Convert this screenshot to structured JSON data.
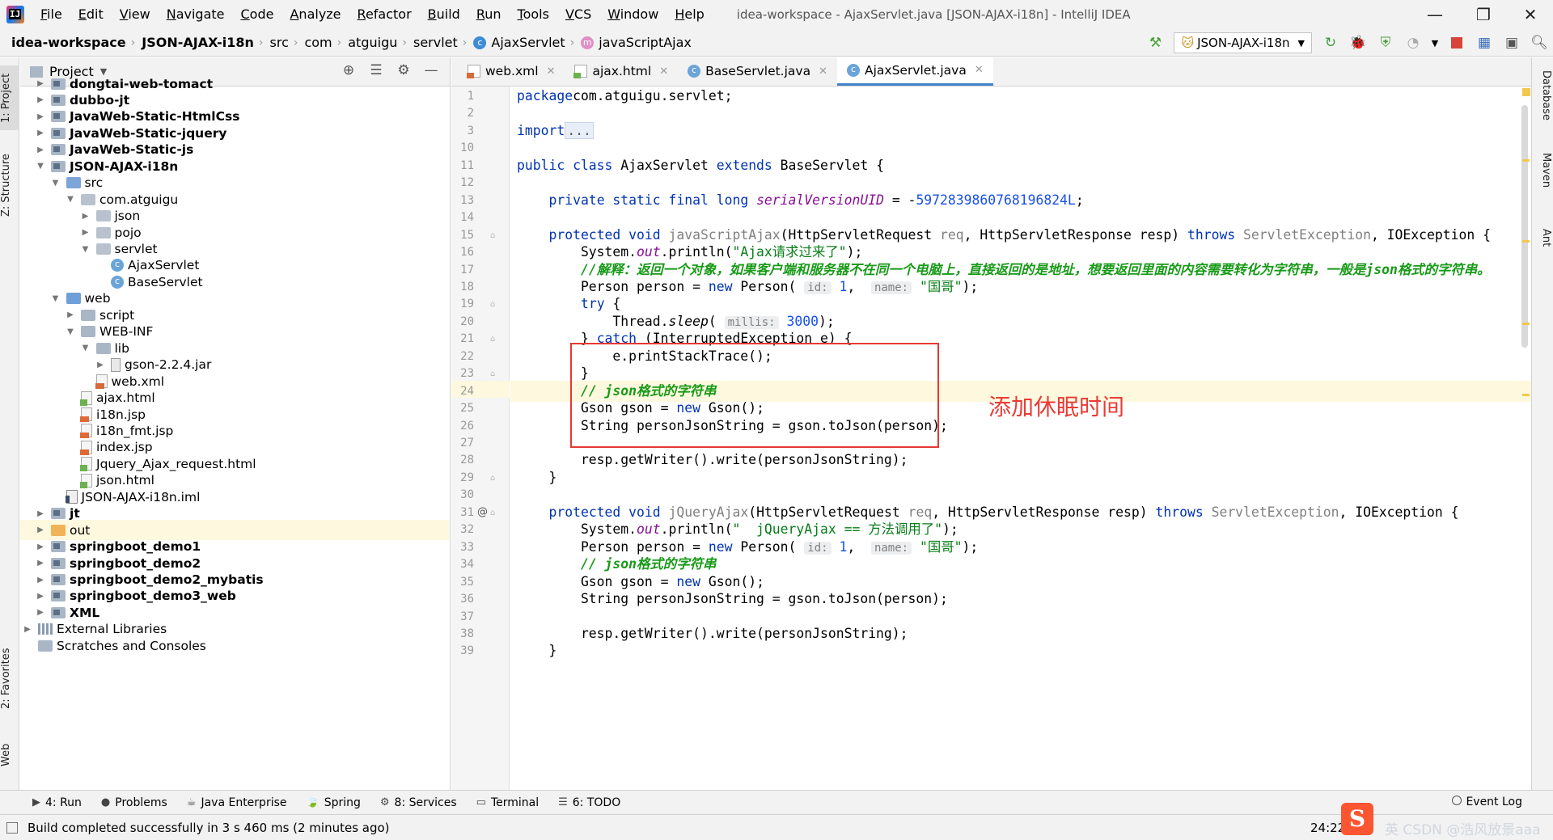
{
  "menubar": {
    "items": [
      "File",
      "Edit",
      "View",
      "Navigate",
      "Code",
      "Analyze",
      "Refactor",
      "Build",
      "Run",
      "Tools",
      "VCS",
      "Window",
      "Help"
    ],
    "title": "idea-workspace - AjaxServlet.java [JSON-AJAX-i18n] - IntelliJ IDEA",
    "minimize": "—",
    "maximize": "❐",
    "close": "✕"
  },
  "breadcrumbs": [
    "idea-workspace",
    "JSON-AJAX-i18n",
    "src",
    "com",
    "atguigu",
    "servlet",
    "AjaxServlet",
    "javaScriptAjax"
  ],
  "toolbar": {
    "run_config": "JSON-AJAX-i18n"
  },
  "left_strip": {
    "project": "1: Project",
    "structure": "Z: Structure",
    "favorites": "2: Favorites",
    "web": "Web"
  },
  "right_strip": {
    "database": "Database",
    "maven": "Maven",
    "ant": "Ant"
  },
  "project_panel": {
    "title": "Project",
    "tree": [
      {
        "label": "dongtai-web-tomact",
        "depth": 0,
        "arrow": "right",
        "icon": "folder-mod",
        "bold": true
      },
      {
        "label": "dubbo-jt",
        "depth": 0,
        "arrow": "right",
        "icon": "folder-mod",
        "bold": true
      },
      {
        "label": "JavaWeb-Static-HtmlCss",
        "depth": 0,
        "arrow": "right",
        "icon": "folder-mod",
        "bold": true
      },
      {
        "label": "JavaWeb-Static-jquery",
        "depth": 0,
        "arrow": "right",
        "icon": "folder-mod",
        "bold": true
      },
      {
        "label": "JavaWeb-Static-js",
        "depth": 0,
        "arrow": "right",
        "icon": "folder-mod",
        "bold": true
      },
      {
        "label": "JSON-AJAX-i18n",
        "depth": 0,
        "arrow": "down",
        "icon": "folder-mod",
        "bold": true
      },
      {
        "label": "src",
        "depth": 1,
        "arrow": "down",
        "icon": "src",
        "bold": false
      },
      {
        "label": "com.atguigu",
        "depth": 2,
        "arrow": "down",
        "icon": "pkg",
        "bold": false
      },
      {
        "label": "json",
        "depth": 3,
        "arrow": "right",
        "icon": "pkg",
        "bold": false
      },
      {
        "label": "pojo",
        "depth": 3,
        "arrow": "right",
        "icon": "pkg",
        "bold": false
      },
      {
        "label": "servlet",
        "depth": 3,
        "arrow": "down",
        "icon": "pkg",
        "bold": false
      },
      {
        "label": "AjaxServlet",
        "depth": 4,
        "arrow": "none",
        "icon": "cls",
        "bold": false
      },
      {
        "label": "BaseServlet",
        "depth": 4,
        "arrow": "none",
        "icon": "cls",
        "bold": false
      },
      {
        "label": "web",
        "depth": 1,
        "arrow": "down",
        "icon": "web",
        "bold": false
      },
      {
        "label": "script",
        "depth": 2,
        "arrow": "right",
        "icon": "folder",
        "bold": false
      },
      {
        "label": "WEB-INF",
        "depth": 2,
        "arrow": "down",
        "icon": "folder",
        "bold": false
      },
      {
        "label": "lib",
        "depth": 3,
        "arrow": "down",
        "icon": "folder",
        "bold": false
      },
      {
        "label": "gson-2.2.4.jar",
        "depth": 4,
        "arrow": "right",
        "icon": "jar",
        "bold": false
      },
      {
        "label": "web.xml",
        "depth": 3,
        "arrow": "none",
        "icon": "xml",
        "bold": false
      },
      {
        "label": "ajax.html",
        "depth": 2,
        "arrow": "none",
        "icon": "html",
        "bold": false
      },
      {
        "label": "i18n.jsp",
        "depth": 2,
        "arrow": "none",
        "icon": "jsp",
        "bold": false
      },
      {
        "label": "i18n_fmt.jsp",
        "depth": 2,
        "arrow": "none",
        "icon": "jsp",
        "bold": false
      },
      {
        "label": "index.jsp",
        "depth": 2,
        "arrow": "none",
        "icon": "jsp",
        "bold": false
      },
      {
        "label": "Jquery_Ajax_request.html",
        "depth": 2,
        "arrow": "none",
        "icon": "html",
        "bold": false
      },
      {
        "label": "json.html",
        "depth": 2,
        "arrow": "none",
        "icon": "html",
        "bold": false
      },
      {
        "label": "JSON-AJAX-i18n.iml",
        "depth": 1,
        "arrow": "none",
        "icon": "iml",
        "bold": false
      },
      {
        "label": "jt",
        "depth": 0,
        "arrow": "right",
        "icon": "folder-mod",
        "bold": true
      },
      {
        "label": "out",
        "depth": 0,
        "arrow": "right",
        "icon": "out",
        "bold": false,
        "highlight": true
      },
      {
        "label": "springboot_demo1",
        "depth": 0,
        "arrow": "right",
        "icon": "folder-mod",
        "bold": true
      },
      {
        "label": "springboot_demo2",
        "depth": 0,
        "arrow": "right",
        "icon": "folder-mod",
        "bold": true
      },
      {
        "label": "springboot_demo2_mybatis",
        "depth": 0,
        "arrow": "right",
        "icon": "folder-mod",
        "bold": true
      },
      {
        "label": "springboot_demo3_web",
        "depth": 0,
        "arrow": "right",
        "icon": "folder-mod",
        "bold": true
      },
      {
        "label": "XML",
        "depth": 0,
        "arrow": "right",
        "icon": "folder-mod",
        "bold": true
      },
      {
        "label": "External Libraries",
        "depth": -1,
        "arrow": "right",
        "icon": "lib",
        "bold": false
      },
      {
        "label": "Scratches and Consoles",
        "depth": -1,
        "arrow": "none",
        "icon": "scratch",
        "bold": false
      }
    ]
  },
  "editor_tabs": [
    {
      "label": "web.xml",
      "icon": "xml",
      "active": false
    },
    {
      "label": "ajax.html",
      "icon": "html",
      "active": false
    },
    {
      "label": "BaseServlet.java",
      "icon": "cls",
      "active": false
    },
    {
      "label": "AjaxServlet.java",
      "icon": "cls",
      "active": true
    }
  ],
  "code": {
    "line_numbers": [
      "1",
      "2",
      "3",
      "10",
      "11",
      "12",
      "13",
      "14",
      "15",
      "16",
      "17",
      "18",
      "19",
      "20",
      "21",
      "22",
      "23",
      "24",
      "25",
      "26",
      "27",
      "28",
      "29",
      "30",
      "31",
      "32",
      "33",
      "34",
      "35",
      "36",
      "37",
      "38",
      "39"
    ],
    "current_line": "24",
    "lines": [
      [
        [
          "kw",
          "package"
        ],
        [
          "",
          "com.atguigu.servlet;"
        ]
      ],
      [],
      [
        [
          "kw",
          "import"
        ],
        [
          "",
          ""
        ],
        [
          "fold",
          "..."
        ]
      ],
      [],
      [
        [
          "kw",
          "public class "
        ],
        [
          "",
          "AjaxServlet "
        ],
        [
          "kw",
          "extends "
        ],
        [
          "",
          "BaseServlet {"
        ]
      ],
      [],
      [
        [
          "",
          "    "
        ],
        [
          "kw",
          "private static final long "
        ],
        [
          "field",
          "serialVersionUID"
        ],
        [
          "",
          " = -"
        ],
        [
          "num",
          "5972839860768196824L"
        ],
        [
          "",
          ";"
        ]
      ],
      [],
      [
        [
          "",
          "    "
        ],
        [
          "kw",
          "protected void "
        ],
        [
          "gray",
          "javaScriptAjax"
        ],
        [
          "",
          "(HttpServletRequest "
        ],
        [
          "gray",
          "req"
        ],
        [
          "",
          ", HttpServletResponse resp) "
        ],
        [
          "kw",
          "throws "
        ],
        [
          "gray",
          "ServletException"
        ],
        [
          "",
          ", IOException {"
        ]
      ],
      [
        [
          "",
          "        System."
        ],
        [
          "field",
          "out"
        ],
        [
          "",
          ".println("
        ],
        [
          "str",
          "\"Ajax请求过来了\""
        ],
        [
          "",
          ");"
        ]
      ],
      [
        [
          "",
          "        "
        ],
        [
          "cmt-green",
          "//解释：返回一个对象，如果客户端和服务器不在同一个电脑上，直接返回的是地址，想要返回里面的内容需要转化为字符串，一般是json格式的字符串。"
        ]
      ],
      [
        [
          "",
          "        Person person = "
        ],
        [
          "kw",
          "new "
        ],
        [
          "",
          "Person( "
        ],
        [
          "hint",
          "id:"
        ],
        [
          "",
          " "
        ],
        [
          "num",
          "1"
        ],
        [
          "",
          ",  "
        ],
        [
          "hint",
          "name:"
        ],
        [
          "",
          " "
        ],
        [
          "str",
          "\"国哥\""
        ],
        [
          "",
          ");"
        ]
      ],
      [
        [
          "",
          "        "
        ],
        [
          "kw",
          "try "
        ],
        [
          "",
          "{"
        ]
      ],
      [
        [
          "",
          "            Thread."
        ],
        [
          "static-m",
          "sleep"
        ],
        [
          "",
          "( "
        ],
        [
          "hint",
          "millis:"
        ],
        [
          "",
          " "
        ],
        [
          "num",
          "3000"
        ],
        [
          "",
          ");"
        ]
      ],
      [
        [
          "",
          "        } "
        ],
        [
          "kw",
          "catch "
        ],
        [
          "",
          "(InterruptedException e) {"
        ]
      ],
      [
        [
          "",
          "            e.printStackTrace();"
        ]
      ],
      [
        [
          "",
          "        }"
        ]
      ],
      [
        [
          "",
          "        "
        ],
        [
          "cmt-green",
          "// json格式的字符串"
        ]
      ],
      [
        [
          "",
          "        Gson gson = "
        ],
        [
          "kw",
          "new "
        ],
        [
          "",
          "Gson();"
        ]
      ],
      [
        [
          "",
          "        String personJsonString = gson.toJson(person);"
        ]
      ],
      [],
      [
        [
          "",
          "        resp.getWriter().write(personJsonString);"
        ]
      ],
      [
        [
          "",
          "    }"
        ]
      ],
      [],
      [
        [
          "",
          "    "
        ],
        [
          "kw",
          "protected void "
        ],
        [
          "gray",
          "jQueryAjax"
        ],
        [
          "",
          "(HttpServletRequest "
        ],
        [
          "gray",
          "req"
        ],
        [
          "",
          ", HttpServletResponse resp) "
        ],
        [
          "kw",
          "throws "
        ],
        [
          "gray",
          "ServletException"
        ],
        [
          "",
          ", IOException {"
        ]
      ],
      [
        [
          "",
          "        System."
        ],
        [
          "field",
          "out"
        ],
        [
          "",
          ".println("
        ],
        [
          "str",
          "\"  jQueryAjax == 方法调用了\""
        ],
        [
          "",
          ");"
        ]
      ],
      [
        [
          "",
          "        Person person = "
        ],
        [
          "kw",
          "new "
        ],
        [
          "",
          "Person( "
        ],
        [
          "hint",
          "id:"
        ],
        [
          "",
          " "
        ],
        [
          "num",
          "1"
        ],
        [
          "",
          ",  "
        ],
        [
          "hint",
          "name:"
        ],
        [
          "",
          " "
        ],
        [
          "str",
          "\"国哥\""
        ],
        [
          "",
          ");"
        ]
      ],
      [
        [
          "",
          "        "
        ],
        [
          "cmt-green",
          "// json格式的字符串"
        ]
      ],
      [
        [
          "",
          "        Gson gson = "
        ],
        [
          "kw",
          "new "
        ],
        [
          "",
          "Gson();"
        ]
      ],
      [
        [
          "",
          "        String personJsonString = gson.toJson(person);"
        ]
      ],
      [],
      [
        [
          "",
          "        resp.getWriter().write(personJsonString);"
        ]
      ],
      [
        [
          "",
          "    }"
        ]
      ]
    ]
  },
  "annotation": {
    "text": "添加休眠时间",
    "color": "#ea3b35"
  },
  "bottom_tools": [
    {
      "label": "4: Run",
      "icon": "▶"
    },
    {
      "label": "Problems",
      "icon": "●"
    },
    {
      "label": "Java Enterprise",
      "icon": "☕"
    },
    {
      "label": "Spring",
      "icon": "🍃"
    },
    {
      "label": "8: Services",
      "icon": "⚙"
    },
    {
      "label": "Terminal",
      "icon": "▭"
    },
    {
      "label": "6: TODO",
      "icon": "☰"
    }
  ],
  "event_log": "Event Log",
  "status": {
    "message": "Build completed successfully in 3 s 460 ms (2 minutes ago)",
    "cursor": "24:22",
    "watermark": "英  CSDN @浩风放景aaa"
  }
}
